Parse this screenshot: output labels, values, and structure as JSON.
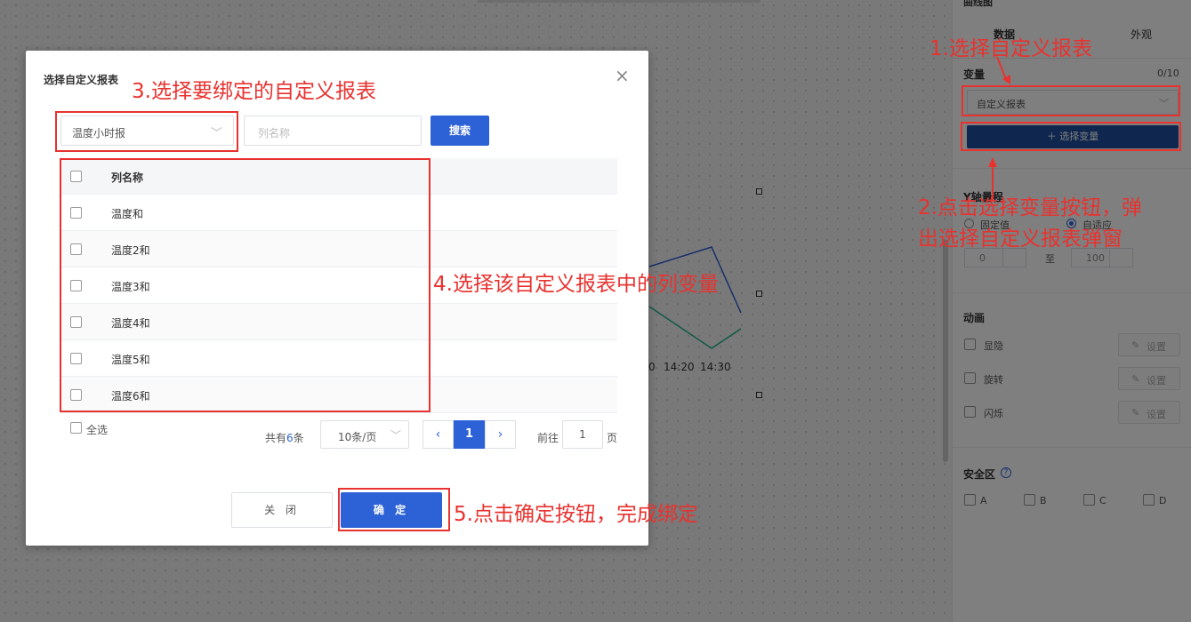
{
  "right_panel": {
    "title": "曲线图",
    "tabs": [
      "数据",
      "外观"
    ],
    "variable_label": "变量",
    "variable_count": "0/10",
    "variable_type": "自定义报表",
    "select_variable_button": "选择变量",
    "y_axis_label": "Y轴量程",
    "y_axis_fixed": "固定值",
    "y_axis_auto": "自适应",
    "y_min": "0",
    "y_to": "至",
    "y_max": "100",
    "animation_label": "动画",
    "animations": [
      "显隐",
      "旋转",
      "闪烁"
    ],
    "settings_label": "设置",
    "safe_zone_label": "安全区",
    "safe_zones": [
      "A",
      "B",
      "C",
      "D"
    ]
  },
  "chart": {
    "x_ticks": [
      "0",
      "14:20",
      "14:30"
    ]
  },
  "dialog": {
    "title": "选择自定义报表",
    "report_select": "温度小时报",
    "column_search_placeholder": "列名称",
    "search_button": "搜索",
    "table_header": "列名称",
    "rows": [
      "温度和",
      "温度2和",
      "温度3和",
      "温度4和",
      "温度5和",
      "温度6和"
    ],
    "select_all": "全选",
    "total_prefix": "共有",
    "total_count": "6",
    "total_suffix": "条",
    "page_size": "10条/页",
    "current_page": "1",
    "goto_label": "前往",
    "goto_value": "1",
    "page_unit": "页",
    "close_button": "关 闭",
    "ok_button": "确 定"
  },
  "annotations": {
    "step1": "1.选择自定义报表",
    "step2_line1": "2.点击选择变量按钮，弹",
    "step2_line2": "出选择自定义报表弹窗",
    "step3": "3.选择要绑定的自定义报表",
    "step4": "4.选择该自定义报表中的列变量",
    "step5": "5.点击确定按钮，完成绑定"
  },
  "colors": {
    "primary": "#2d62d6",
    "annotation": "#e8322f",
    "panel_button": "#1f4f9e"
  }
}
